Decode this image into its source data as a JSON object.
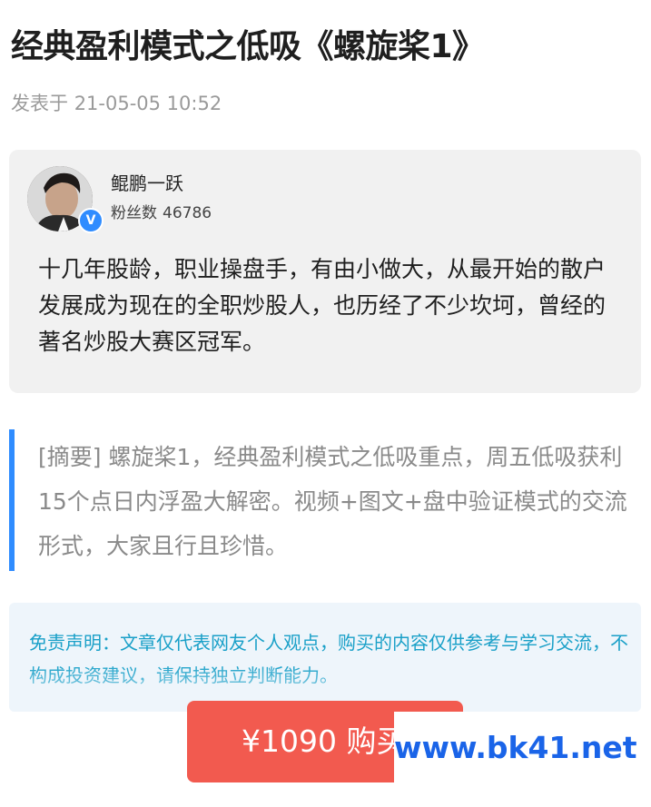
{
  "article": {
    "title": "经典盈利模式之低吸《螺旋桨1》",
    "published_prefix": "发表于",
    "published_time": "21-05-05 10:52"
  },
  "author": {
    "name": "鲲鹏一跃",
    "fans_label": "粉丝数",
    "fans_count": "46786",
    "verified_icon": "verified-badge",
    "bio": "十几年股龄，职业操盘手，有由小做大，从最开始的散户发展成为现在的全职炒股人，也历经了不少坎坷，曾经的著名炒股大赛区冠军。"
  },
  "summary": {
    "text": "[摘要] 螺旋桨1，经典盈利模式之低吸重点，周五低吸获利15个点日内浮盈大解密。视频+图文+盘中验证模式的交流形式，大家且行且珍惜。"
  },
  "disclaimer": {
    "text": "免责声明：文章仅代表网友个人观点，购买的内容仅供参考与学习交流，不构成投资建议，请保持独立判断能力。"
  },
  "purchase": {
    "price": "¥1090",
    "label": "购买"
  },
  "watermark": {
    "text": "www.bk41.net"
  },
  "colors": {
    "accent_blue": "#2f8cff",
    "buy_red": "#f25a4f",
    "disclaimer_text": "#1aa0c8",
    "watermark_blue": "#1a64e8"
  }
}
